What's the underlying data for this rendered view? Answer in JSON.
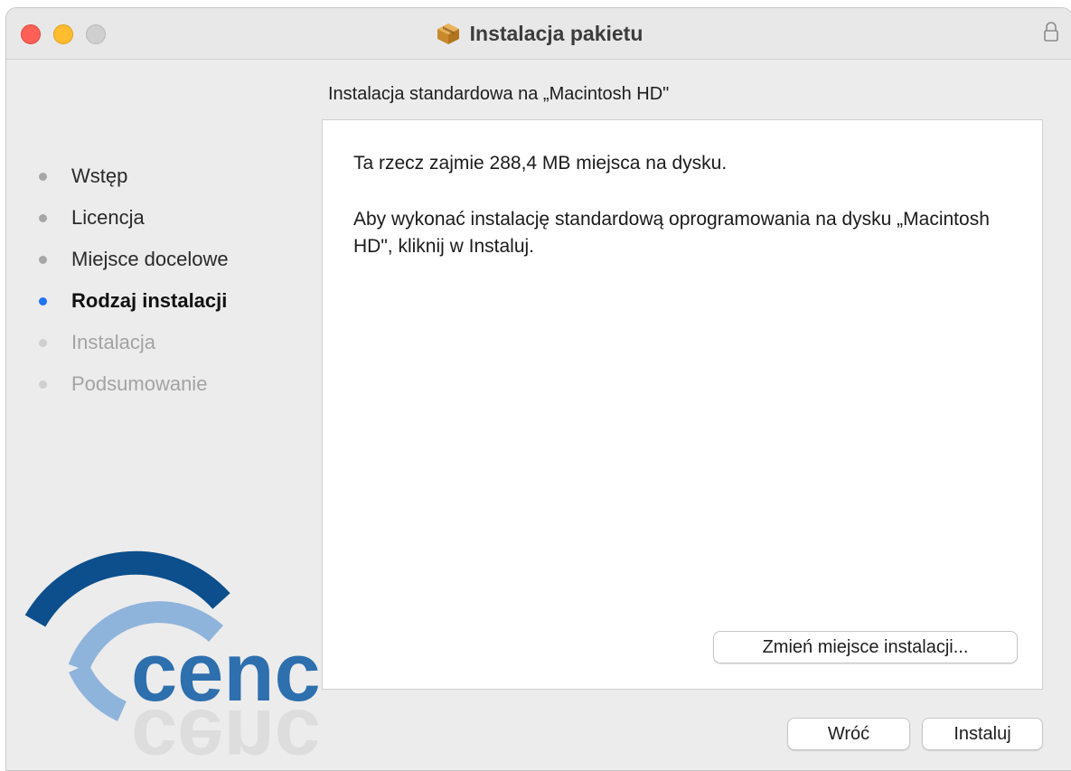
{
  "window": {
    "title": "Instalacja pakietu",
    "subtitle": "Instalacja standardowa na „Macintosh HD\""
  },
  "steps": [
    {
      "label": "Wstęp",
      "state": "done"
    },
    {
      "label": "Licencja",
      "state": "done"
    },
    {
      "label": "Miejsce docelowe",
      "state": "done"
    },
    {
      "label": "Rodzaj instalacji",
      "state": "current"
    },
    {
      "label": "Instalacja",
      "state": "pending"
    },
    {
      "label": "Podsumowanie",
      "state": "pending"
    }
  ],
  "content": {
    "line1": "Ta rzecz zajmie 288,4 MB miejsca na dysku.",
    "line2": "Aby wykonać instalację standardową oprogramowania na dysku „Macintosh HD\", kliknij w Instaluj."
  },
  "buttons": {
    "change_location": "Zmień miejsce instalacji...",
    "back": "Wróć",
    "install": "Instaluj"
  },
  "logo": {
    "text": "cenc",
    "icon": "cencu-logo"
  },
  "colors": {
    "accent": "#1f74f2",
    "close": "#fe5f57",
    "minimize": "#febc2e",
    "logo_dark": "#0d4f8c",
    "logo_light": "#7aa6d6"
  }
}
